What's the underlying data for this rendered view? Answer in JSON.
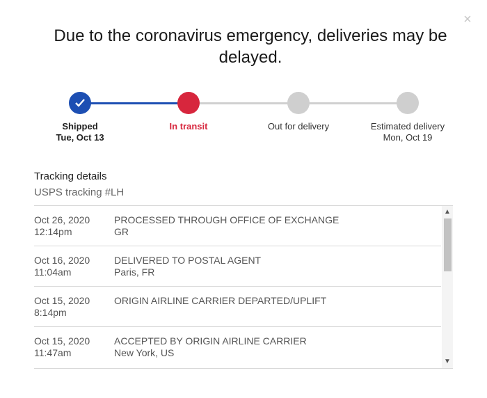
{
  "close_icon": "×",
  "headline": "Due to the coronavirus emergency, deliveries may be delayed.",
  "progress": {
    "steps": [
      {
        "label": "Shipped",
        "date": "Tue, Oct 13",
        "state": "complete"
      },
      {
        "label": "In transit",
        "date": "",
        "state": "current"
      },
      {
        "label": "Out for delivery",
        "date": "",
        "state": "pending"
      },
      {
        "label": "Estimated delivery",
        "date": "Mon, Oct 19",
        "state": "pending"
      }
    ]
  },
  "tracking": {
    "title": "Tracking details",
    "number_label": "USPS tracking #LH",
    "events": [
      {
        "date": "Oct 26, 2020",
        "time": "12:14pm",
        "status": "PROCESSED THROUGH OFFICE OF EXCHANGE",
        "location": "GR"
      },
      {
        "date": "Oct 16, 2020",
        "time": "11:04am",
        "status": "DELIVERED TO POSTAL AGENT",
        "location": "Paris, FR"
      },
      {
        "date": "Oct 15, 2020",
        "time": "8:14pm",
        "status": "ORIGIN AIRLINE CARRIER DEPARTED/UPLIFT",
        "location": ""
      },
      {
        "date": "Oct 15, 2020",
        "time": "11:47am",
        "status": "ACCEPTED BY ORIGIN AIRLINE CARRIER",
        "location": "New York, US"
      }
    ]
  },
  "scrollbar": {
    "up_icon": "▲",
    "down_icon": "▼"
  },
  "colors": {
    "complete": "#1d4fb3",
    "current": "#d7263d",
    "pending": "#cfcfcf"
  }
}
